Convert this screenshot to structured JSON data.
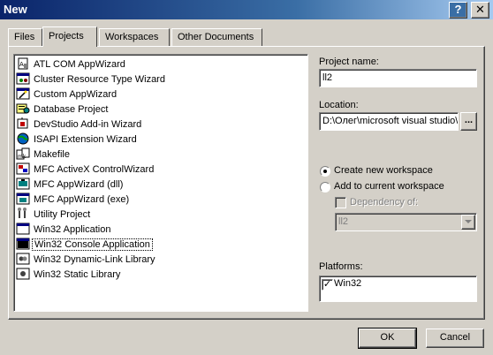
{
  "window": {
    "title": "New",
    "help_glyph": "?",
    "close_glyph": "✕"
  },
  "tabs": [
    {
      "label": "Files"
    },
    {
      "label": "Projects"
    },
    {
      "label": "Workspaces"
    },
    {
      "label": "Other Documents"
    }
  ],
  "active_tab": "Projects",
  "projects": [
    {
      "label": "ATL COM AppWizard",
      "icon": "atl-com-icon"
    },
    {
      "label": "Cluster Resource Type Wizard",
      "icon": "cluster-icon"
    },
    {
      "label": "Custom AppWizard",
      "icon": "custom-appwizard-icon"
    },
    {
      "label": "Database Project",
      "icon": "database-icon"
    },
    {
      "label": "DevStudio Add-in Wizard",
      "icon": "devstudio-addin-icon"
    },
    {
      "label": "ISAPI Extension Wizard",
      "icon": "isapi-globe-icon"
    },
    {
      "label": "Makefile",
      "icon": "makefile-icon"
    },
    {
      "label": "MFC ActiveX ControlWizard",
      "icon": "mfc-activex-icon"
    },
    {
      "label": "MFC AppWizard (dll)",
      "icon": "mfc-dll-icon"
    },
    {
      "label": "MFC AppWizard (exe)",
      "icon": "mfc-exe-icon"
    },
    {
      "label": "Utility Project",
      "icon": "utility-icon"
    },
    {
      "label": "Win32 Application",
      "icon": "win32-app-icon"
    },
    {
      "label": "Win32 Console Application",
      "icon": "win32-console-icon"
    },
    {
      "label": "Win32 Dynamic-Link Library",
      "icon": "win32-dll-icon"
    },
    {
      "label": "Win32 Static Library",
      "icon": "win32-lib-icon"
    }
  ],
  "selected_project": "Win32 Console Application",
  "project_name": {
    "label": "Project name:",
    "value": "ll2"
  },
  "location": {
    "label": "Location:",
    "value": "D:\\Олег\\microsoft visual studio\\",
    "browse_label": "..."
  },
  "workspace": {
    "create_label": "Create new workspace",
    "add_label": "Add to current workspace",
    "create_selected": true,
    "dependency_label": "Dependency of:",
    "dependency_value": "ll2"
  },
  "platforms": {
    "label": "Platforms:",
    "items": [
      {
        "label": "Win32",
        "checked": true
      }
    ]
  },
  "buttons": {
    "ok": "OK",
    "cancel": "Cancel"
  }
}
